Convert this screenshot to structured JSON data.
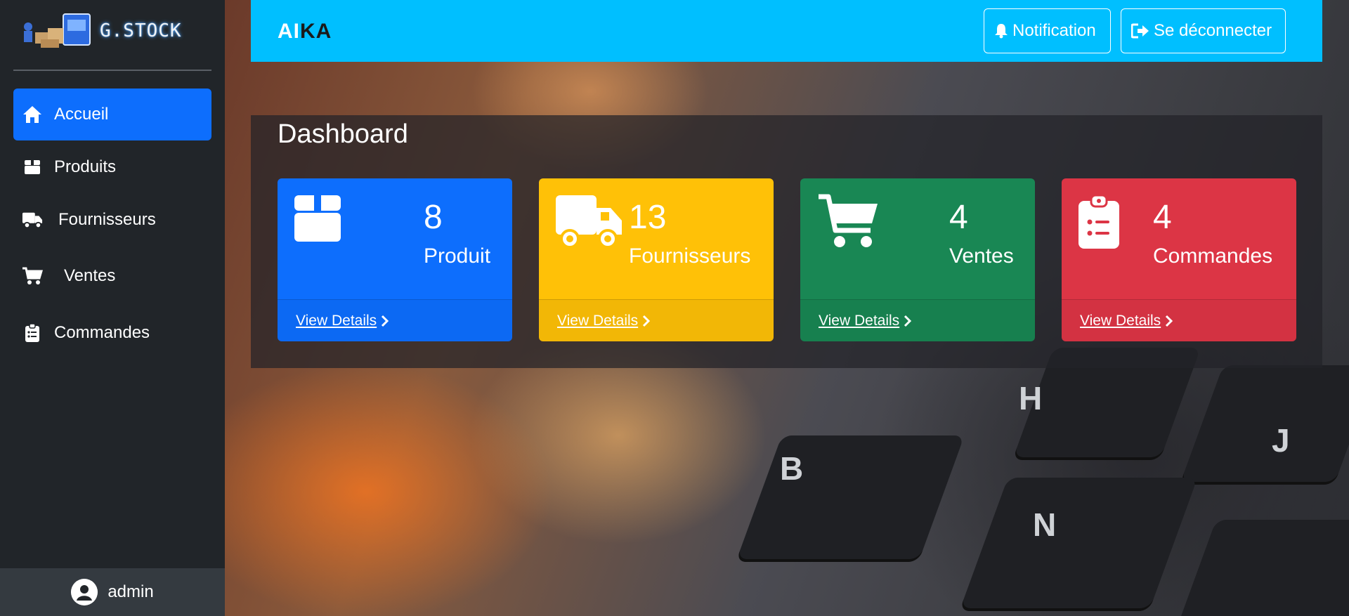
{
  "sidebar": {
    "brand": "G.STOCK",
    "items": [
      {
        "label": "Accueil",
        "icon": "home-icon",
        "active": true
      },
      {
        "label": "Produits",
        "icon": "box-icon",
        "active": false
      },
      {
        "label": "Fournisseurs",
        "icon": "truck-icon",
        "active": false
      },
      {
        "label": "Ventes",
        "icon": "cart-icon",
        "active": false
      },
      {
        "label": "Commandes",
        "icon": "clipboard-icon",
        "active": false
      }
    ],
    "user": "admin"
  },
  "topbar": {
    "title_light": "AI",
    "title_dark": "K",
    "title_end": "A",
    "notification_label": "Notification",
    "logout_label": "Se déconnecter"
  },
  "dashboard": {
    "title": "Dashboard",
    "cards": [
      {
        "count": "8",
        "name": "Produit",
        "link": "View Details",
        "color": "#0d6efd",
        "icon": "box-icon"
      },
      {
        "count": "13",
        "name": "Fournisseurs",
        "link": "View Details",
        "color": "#ffc107",
        "icon": "truck-icon"
      },
      {
        "count": "4",
        "name": "Ventes",
        "link": "View Details",
        "color": "#198754",
        "icon": "cart-icon"
      },
      {
        "count": "4",
        "name": "Commandes",
        "link": "View Details",
        "color": "#dc3545",
        "icon": "clipboard-icon"
      }
    ]
  },
  "background_keys": [
    "H",
    "J",
    "B",
    "N"
  ]
}
